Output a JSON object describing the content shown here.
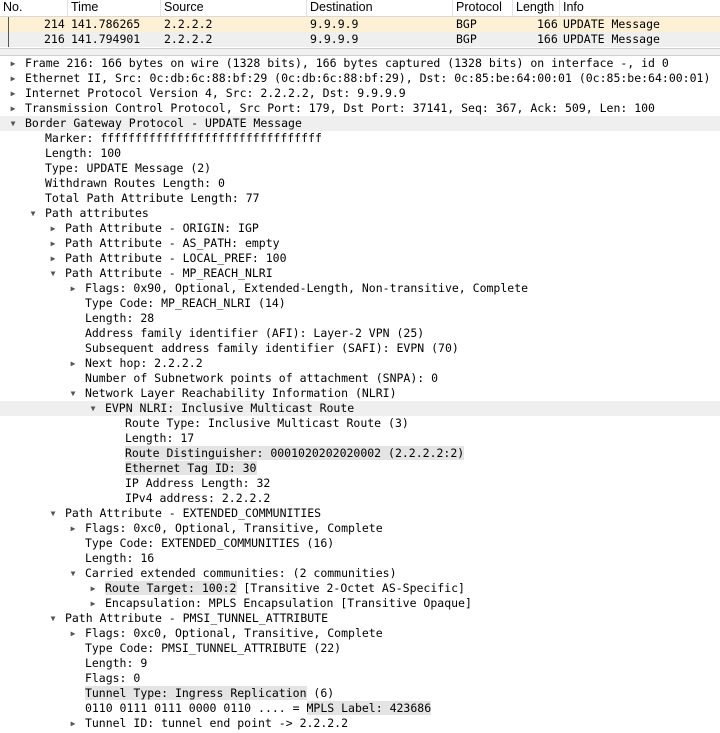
{
  "packet_list": {
    "columns": [
      "No.",
      "Time",
      "Source",
      "Destination",
      "Protocol",
      "Length",
      "Info"
    ],
    "rows": [
      {
        "no": "214",
        "time": "141.786265",
        "source": "2.2.2.2",
        "destination": "9.9.9.9",
        "protocol": "BGP",
        "length": "166",
        "info": "UPDATE Message"
      },
      {
        "no": "216",
        "time": "141.794901",
        "source": "2.2.2.2",
        "destination": "9.9.9.9",
        "protocol": "BGP",
        "length": "166",
        "info": "UPDATE Message"
      }
    ]
  },
  "colors": {
    "selected_row": "#fdf0d5",
    "alt_row": "#efefef",
    "highlight": "#e4e4e4"
  },
  "tree": [
    {
      "indent": 0,
      "toggle": "collapsed",
      "text": "Frame 216: 166 bytes on wire (1328 bits), 166 bytes captured (1328 bits) on interface -, id 0"
    },
    {
      "indent": 0,
      "toggle": "collapsed",
      "text": "Ethernet II, Src: 0c:db:6c:88:bf:29 (0c:db:6c:88:bf:29), Dst: 0c:85:be:64:00:01 (0c:85:be:64:00:01)"
    },
    {
      "indent": 0,
      "toggle": "collapsed",
      "text": "Internet Protocol Version 4, Src: 2.2.2.2, Dst: 9.9.9.9"
    },
    {
      "indent": 0,
      "toggle": "collapsed",
      "text": "Transmission Control Protocol, Src Port: 179, Dst Port: 37141, Seq: 367, Ack: 509, Len: 100"
    },
    {
      "indent": 0,
      "toggle": "expanded",
      "text": "Border Gateway Protocol - UPDATE Message",
      "rowhl": true
    },
    {
      "indent": 1,
      "toggle": "none",
      "text": "Marker: ffffffffffffffffffffffffffffffff"
    },
    {
      "indent": 1,
      "toggle": "none",
      "text": "Length: 100"
    },
    {
      "indent": 1,
      "toggle": "none",
      "text": "Type: UPDATE Message (2)"
    },
    {
      "indent": 1,
      "toggle": "none",
      "text": "Withdrawn Routes Length: 0"
    },
    {
      "indent": 1,
      "toggle": "none",
      "text": "Total Path Attribute Length: 77"
    },
    {
      "indent": 1,
      "toggle": "expanded",
      "text": "Path attributes"
    },
    {
      "indent": 2,
      "toggle": "collapsed",
      "text": "Path Attribute - ORIGIN: IGP"
    },
    {
      "indent": 2,
      "toggle": "collapsed",
      "text": "Path Attribute - AS_PATH: empty"
    },
    {
      "indent": 2,
      "toggle": "collapsed",
      "text": "Path Attribute - LOCAL_PREF: 100"
    },
    {
      "indent": 2,
      "toggle": "expanded",
      "text": "Path Attribute - MP_REACH_NLRI"
    },
    {
      "indent": 3,
      "toggle": "collapsed",
      "text": "Flags: 0x90, Optional, Extended-Length, Non-transitive, Complete"
    },
    {
      "indent": 3,
      "toggle": "none",
      "text": "Type Code: MP_REACH_NLRI (14)"
    },
    {
      "indent": 3,
      "toggle": "none",
      "text": "Length: 28"
    },
    {
      "indent": 3,
      "toggle": "none",
      "text": "Address family identifier (AFI): Layer-2 VPN (25)"
    },
    {
      "indent": 3,
      "toggle": "none",
      "text": "Subsequent address family identifier (SAFI): EVPN (70)"
    },
    {
      "indent": 3,
      "toggle": "collapsed",
      "text": "Next hop: 2.2.2.2"
    },
    {
      "indent": 3,
      "toggle": "none",
      "text": "Number of Subnetwork points of attachment (SNPA): 0"
    },
    {
      "indent": 3,
      "toggle": "expanded",
      "text": "Network Layer Reachability Information (NLRI)"
    },
    {
      "indent": 4,
      "toggle": "expanded",
      "text": "EVPN NLRI: Inclusive Multicast Route",
      "rowhl": true
    },
    {
      "indent": 5,
      "toggle": "none",
      "text": "Route Type: Inclusive Multicast Route (3)"
    },
    {
      "indent": 5,
      "toggle": "none",
      "text": "Length: 17"
    },
    {
      "indent": 5,
      "toggle": "none",
      "text": "Route Distinguisher: 0001020202020002 (2.2.2.2:2)",
      "hl": "Route Distinguisher: 0001020202020002 (2.2.2.2:2)"
    },
    {
      "indent": 5,
      "toggle": "none",
      "text": "Ethernet Tag ID: 30",
      "hl": "Ethernet Tag ID: 30"
    },
    {
      "indent": 5,
      "toggle": "none",
      "text": "IP Address Length: 32"
    },
    {
      "indent": 5,
      "toggle": "none",
      "text": "IPv4 address: 2.2.2.2"
    },
    {
      "indent": 2,
      "toggle": "expanded",
      "text": "Path Attribute - EXTENDED_COMMUNITIES"
    },
    {
      "indent": 3,
      "toggle": "collapsed",
      "text": "Flags: 0xc0, Optional, Transitive, Complete"
    },
    {
      "indent": 3,
      "toggle": "none",
      "text": "Type Code: EXTENDED_COMMUNITIES (16)"
    },
    {
      "indent": 3,
      "toggle": "none",
      "text": "Length: 16"
    },
    {
      "indent": 3,
      "toggle": "expanded",
      "text": "Carried extended communities: (2 communities)"
    },
    {
      "indent": 4,
      "toggle": "collapsed",
      "text": "Route Target: 100:2 [Transitive 2-Octet AS-Specific]",
      "hl": "Route Target: 100:2"
    },
    {
      "indent": 4,
      "toggle": "collapsed",
      "text": "Encapsulation: MPLS Encapsulation [Transitive Opaque]"
    },
    {
      "indent": 2,
      "toggle": "expanded",
      "text": "Path Attribute - PMSI_TUNNEL_ATTRIBUTE"
    },
    {
      "indent": 3,
      "toggle": "collapsed",
      "text": "Flags: 0xc0, Optional, Transitive, Complete"
    },
    {
      "indent": 3,
      "toggle": "none",
      "text": "Type Code: PMSI_TUNNEL_ATTRIBUTE (22)"
    },
    {
      "indent": 3,
      "toggle": "none",
      "text": "Length: 9"
    },
    {
      "indent": 3,
      "toggle": "none",
      "text": "Flags: 0"
    },
    {
      "indent": 3,
      "toggle": "none",
      "text": "Tunnel Type: Ingress Replication (6)",
      "hl": "Tunnel Type: Ingress Replication"
    },
    {
      "indent": 3,
      "toggle": "none",
      "text": "0110 0111 0111 0000 0110 .... = MPLS Label: 423686",
      "hl": "MPLS Label: 423686"
    },
    {
      "indent": 3,
      "toggle": "collapsed",
      "text": "Tunnel ID: tunnel end point -> 2.2.2.2"
    }
  ]
}
